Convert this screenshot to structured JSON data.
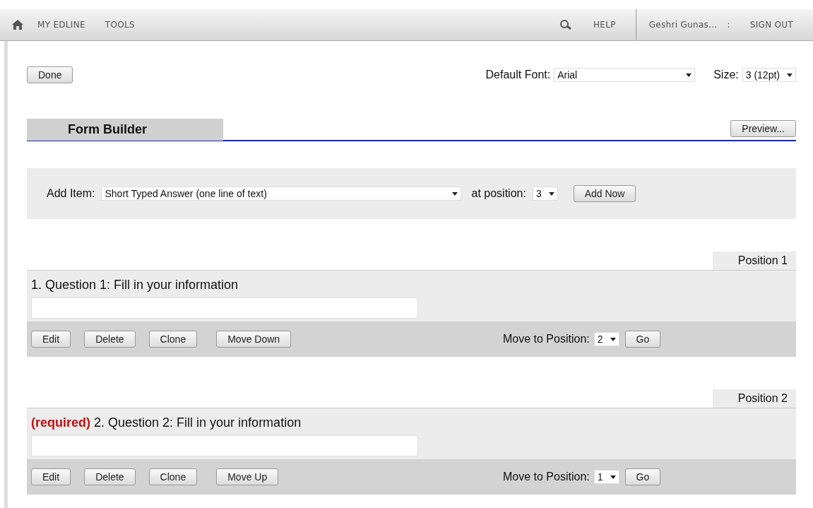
{
  "nav": {
    "left": [
      "MY EDLINE",
      "TOOLS"
    ],
    "help": "HELP",
    "user": "Geshri Gunas...",
    "separator": ":",
    "sign_out": "SIGN OUT"
  },
  "toolbar": {
    "done": "Done",
    "font_label": "Default Font:",
    "font_value": "Arial",
    "size_label": "Size:",
    "size_value": "3 (12pt)"
  },
  "section": {
    "tab": "Form Builder",
    "preview": "Preview..."
  },
  "add_item": {
    "label": "Add Item:",
    "value": "Short Typed Answer (one line of text)",
    "position_label": "at position:",
    "position_value": "3",
    "button": "Add Now"
  },
  "questions": [
    {
      "position": "Position 1",
      "text": "1. Question 1: Fill in your information",
      "buttons": [
        "Edit",
        "Delete",
        "Clone"
      ],
      "move": "Move Down",
      "move_to_label": "Move to Position:",
      "move_to_value": "2",
      "go": "Go"
    },
    {
      "position": "Position 2",
      "required_label": "(required)",
      "text": "2. Question 2: Fill in your information",
      "buttons": [
        "Edit",
        "Delete",
        "Clone"
      ],
      "move": "Move Up",
      "move_to_label": "Move to Position:",
      "move_to_value": "1",
      "go": "Go"
    }
  ]
}
